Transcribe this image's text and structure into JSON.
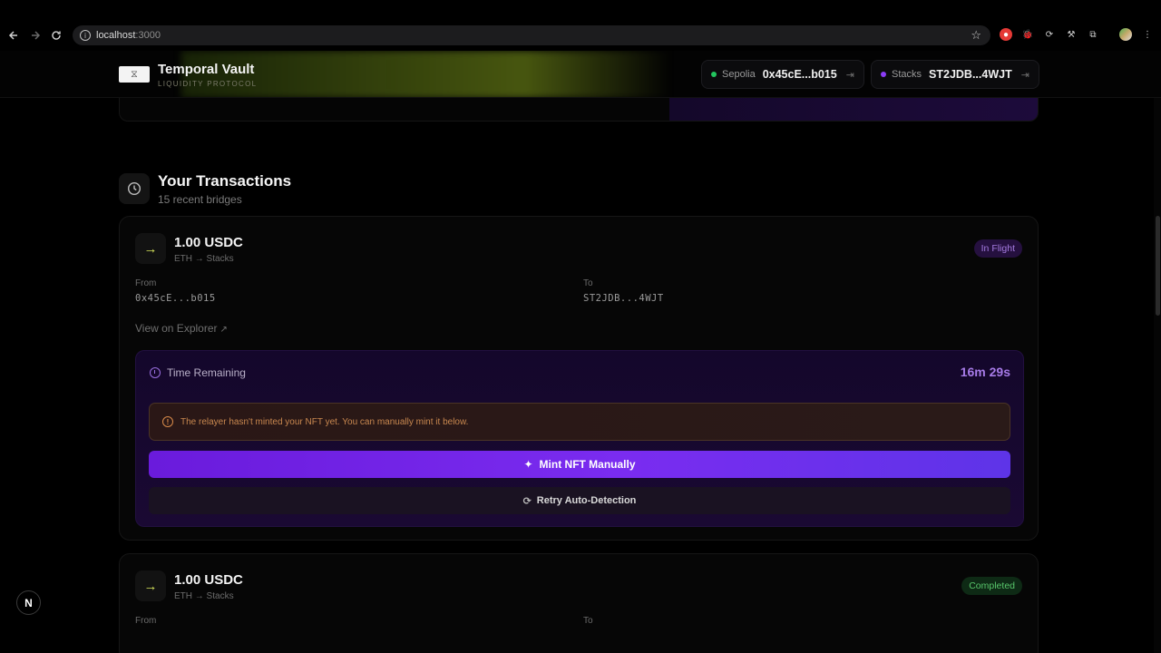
{
  "browser": {
    "url_host": "localhost",
    "url_port": ":3000",
    "extensions": [
      "record-icon",
      "bug-icon",
      "sync-icon",
      "tool-icon",
      "puzzle-icon",
      "profile-avatar"
    ]
  },
  "header": {
    "logo_glyph": "⧖",
    "title": "Temporal Vault",
    "subtitle": "LIQUIDITY PROTOCOL",
    "wallets": [
      {
        "network": "Sepolia",
        "address": "0x45cE...b015",
        "dot_color": "#22c55e"
      },
      {
        "network": "Stacks",
        "address": "ST2JDB...4WJT",
        "dot_color": "#8b3cf6"
      }
    ]
  },
  "section": {
    "title": "Your Transactions",
    "subtitle": "15 recent bridges"
  },
  "transactions": [
    {
      "amount": "1.00 USDC",
      "route": "ETH → Stacks",
      "status": "In Flight",
      "from_label": "From",
      "from": "0x45cE...b015",
      "to_label": "To",
      "to": "ST2JDB...4WJT",
      "explorer_link": "View on Explorer",
      "time_label": "Time Remaining",
      "time_value": "16m 29s",
      "warning": "The relayer hasn't minted your NFT yet. You can manually mint it below.",
      "mint_button": "Mint NFT Manually",
      "retry_button": "Retry Auto-Detection"
    },
    {
      "amount": "1.00 USDC",
      "route": "ETH → Stacks",
      "status": "Completed",
      "from_label": "From",
      "to_label": "To"
    }
  ],
  "dev_indicator": "N",
  "colors": {
    "accent_purple": "#7a2cf0",
    "accent_lime": "#d3e05a",
    "status_flight": "#a57be0",
    "status_completed": "#58c66b",
    "warning": "#c9884f"
  }
}
